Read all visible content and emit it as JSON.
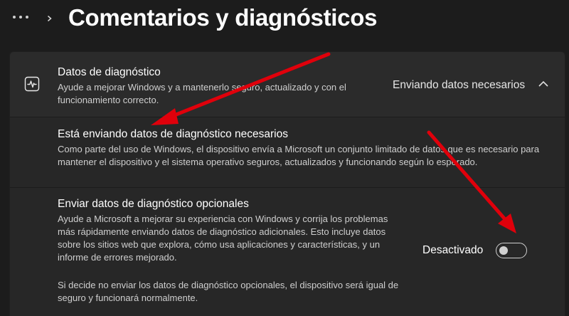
{
  "header": {
    "more_icon": "more-dots-icon",
    "breadcrumb_icon": "chevron-right-icon",
    "title": "Comentarios y diagnósticos"
  },
  "diagnostic_data": {
    "icon": "diagnostic-pulse-icon",
    "title": "Datos de diagnóstico",
    "description": "Ayude a mejorar Windows y a mantenerlo seguro, actualizado y con el funcionamiento correcto.",
    "status": "Enviando datos necesarios",
    "expand_icon": "chevron-up-icon"
  },
  "required_data": {
    "title": "Está enviando datos de diagnóstico necesarios",
    "description": "Como parte del uso de Windows, el dispositivo envía a Microsoft un conjunto limitado de datos que es necesario para mantener el dispositivo y el sistema operativo seguros, actualizados y funcionando según lo esperado."
  },
  "optional_data": {
    "title": "Enviar datos de diagnóstico opcionales",
    "description": "Ayude a Microsoft a mejorar su experiencia con Windows y corrija los problemas más rápidamente enviando datos de diagnóstico adicionales. Esto incluye datos sobre los sitios web que explora, cómo usa aplicaciones y características, y un informe de errores mejorado.",
    "note": "Si decide no enviar los datos de diagnóstico opcionales, el dispositivo será igual de seguro y funcionará normalmente.",
    "toggle_label": "Desactivado",
    "toggle_on": false
  },
  "colors": {
    "background": "#1c1c1c",
    "card": "#2b2b2b",
    "annotation_arrow": "#e0000b"
  }
}
